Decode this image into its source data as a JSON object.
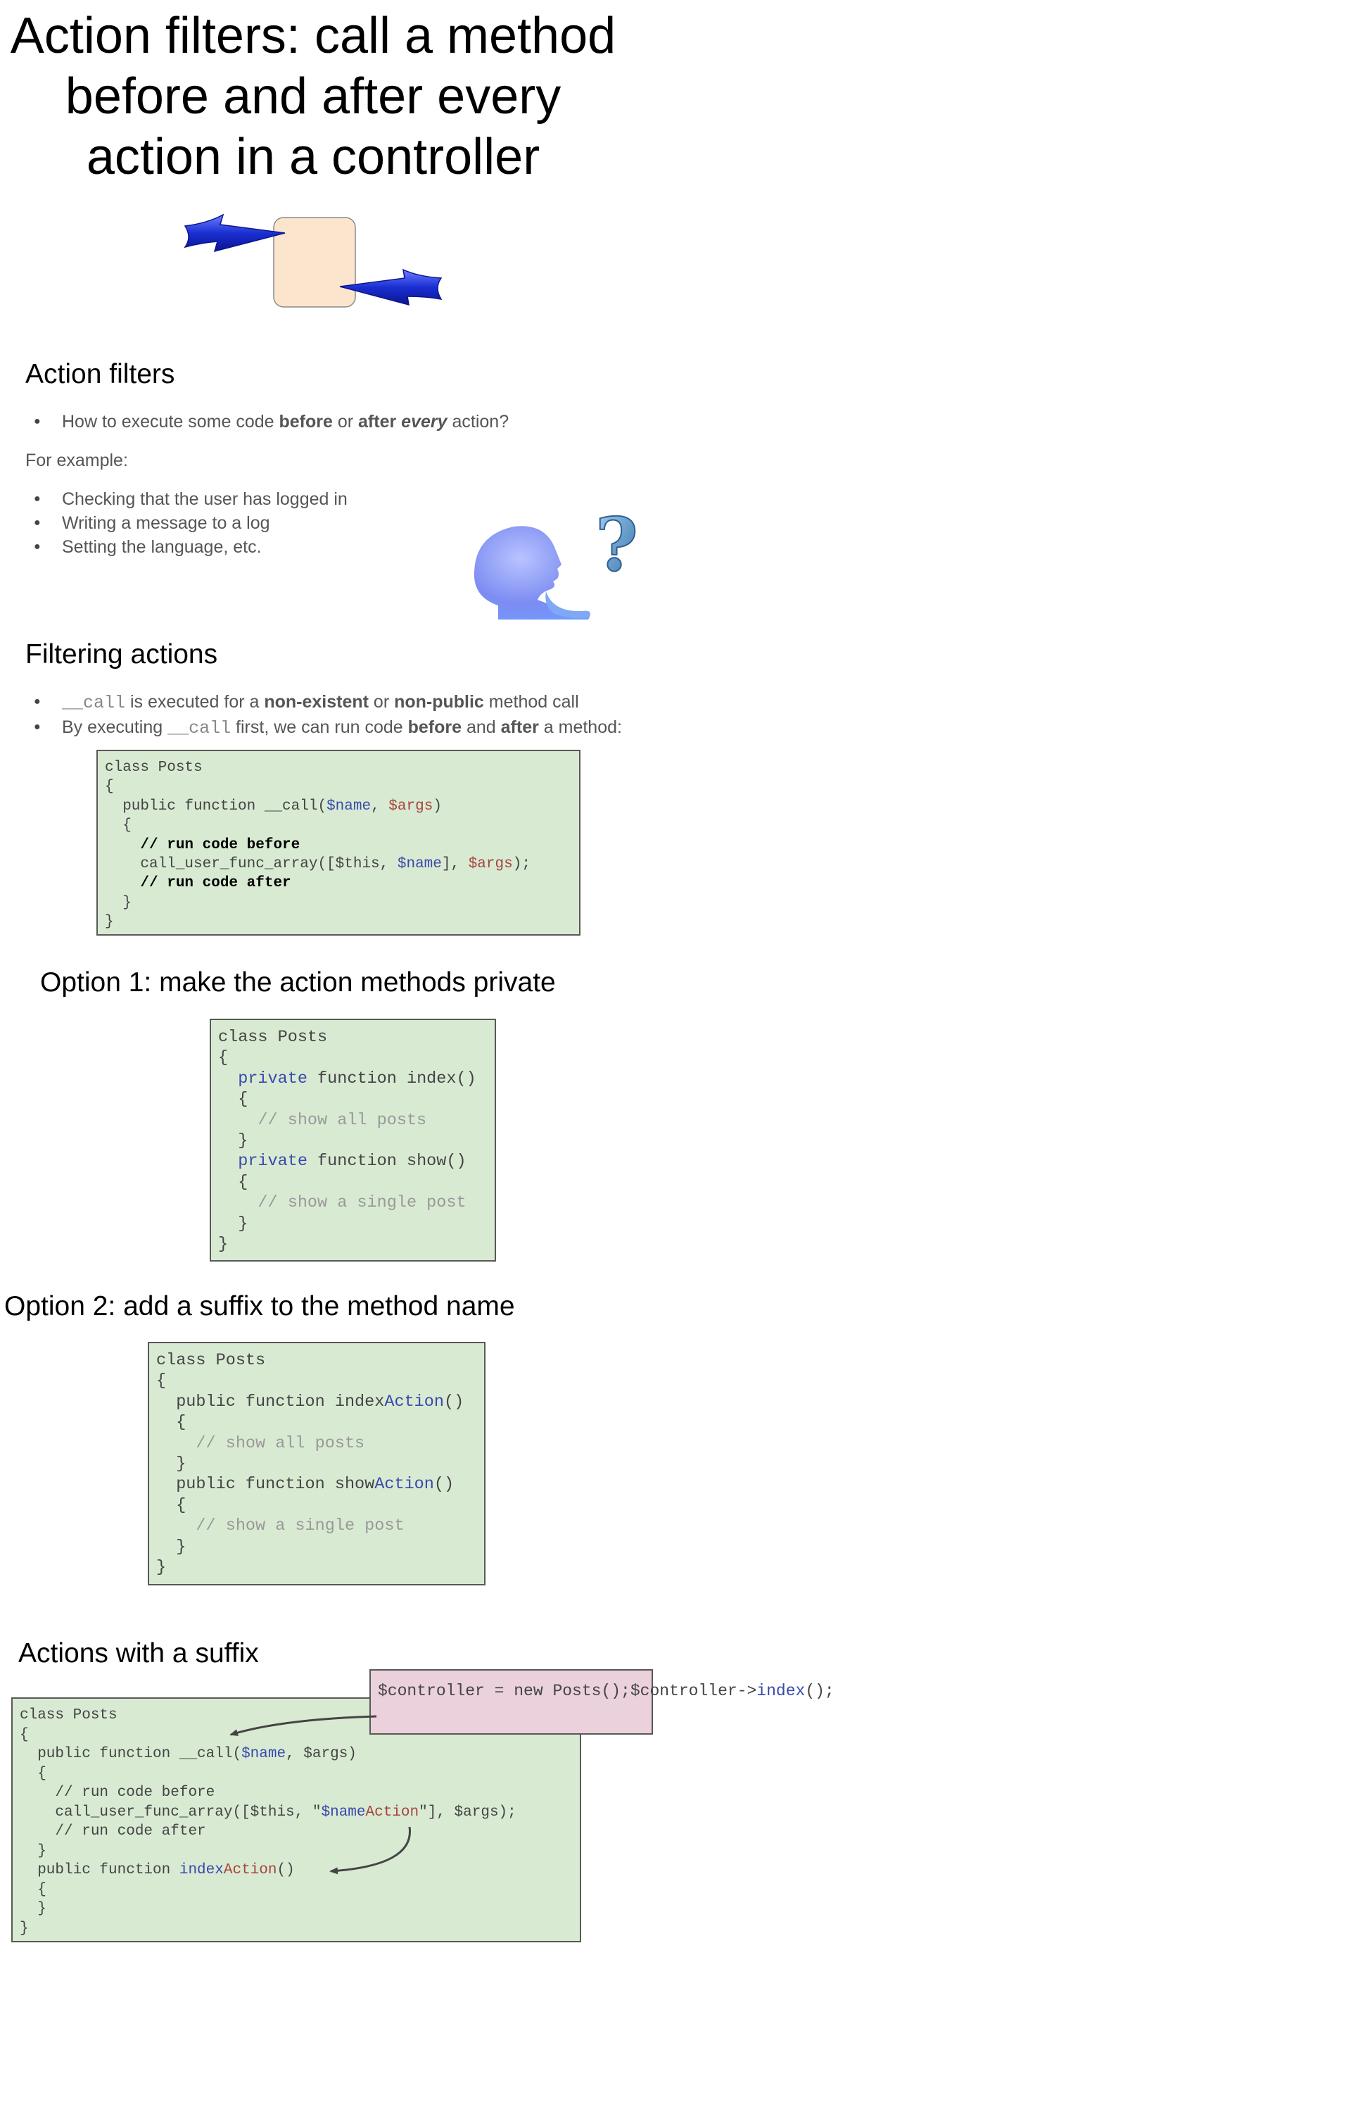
{
  "slide1": {
    "title_lines": [
      "Action filters: call a method",
      "before and after every",
      "action in a controller"
    ]
  },
  "slide2": {
    "heading": "Action filters",
    "bullet1": {
      "pre": "How to execute some code ",
      "b1": "before",
      "mid": " or ",
      "b2": "after",
      "sp": " ",
      "em": "every",
      "post": " action?"
    },
    "for_example": "For example:",
    "bullets": [
      "Checking that the user has logged in",
      "Writing a message to a log",
      "Setting the language, etc."
    ],
    "icon": "thinking-person-question-icon"
  },
  "slide3": {
    "heading": "Filtering actions",
    "bullet1": {
      "code": "__call",
      "mid1": " is executed for a ",
      "b1": "non-existent",
      "mid2": " or ",
      "b2": "non-public",
      "post": " method call"
    },
    "bullet2": {
      "pre": "By executing ",
      "code": "__call",
      "mid1": " first, we can run code ",
      "b1": "before",
      "mid2": " and ",
      "b2": "after",
      "post": " a method:"
    },
    "code": {
      "l1": "class Posts",
      "l2": "{",
      "l3a": "  public function __call(",
      "l3b": "$name",
      "l3c": ", ",
      "l3d": "$args",
      "l3e": ")",
      "l4": "  {",
      "l5": "    // run code before",
      "l6a": "    call_user_func_array([$this, ",
      "l6b": "$name",
      "l6c": "], ",
      "l6d": "$args",
      "l6e": ");",
      "l7": "    // run code after",
      "l8": "  }",
      "l9": "}"
    }
  },
  "slide4": {
    "heading": "Option 1: make the action methods private",
    "code": {
      "l1": "class Posts",
      "l2": "{",
      "l3a": "  ",
      "l3b": "private",
      "l3c": " function index()",
      "l4": "  {",
      "l5": "    // show all posts",
      "l6": "  }",
      "l7a": "  ",
      "l7b": "private",
      "l7c": " function show()",
      "l8": "  {",
      "l9": "    // show a single post",
      "l10": "  }",
      "l11": "}"
    }
  },
  "slide5": {
    "heading": "Option 2: add a suffix to the method name",
    "code": {
      "l1": "class Posts",
      "l2": "{",
      "l3a": "  public function index",
      "l3b": "Action",
      "l3c": "()",
      "l4": "  {",
      "l5": "    // show all posts",
      "l6": "  }",
      "l7a": "  public function show",
      "l7b": "Action",
      "l7c": "()",
      "l8": "  {",
      "l9": "    // show a single post",
      "l10": "  }",
      "l11": "}"
    }
  },
  "slide6": {
    "heading": "Actions with a suffix",
    "code": {
      "l1": "class Posts",
      "l2": "{",
      "l3a": "  public function __call(",
      "l3b": "$name",
      "l3c": ", $args)",
      "l4": "  {",
      "l5": "    // run code before",
      "l6a": "    call_user_func_array([$this, \"",
      "l6b": "$name",
      "l6c": "Action",
      "l6d": "\"], $args);",
      "l7": "    // run code after",
      "l8": "  }",
      "l9a": "  public function ",
      "l9b": "index",
      "l9c": "Action",
      "l9d": "()",
      "l10": "  {",
      "l11": "  }",
      "l12": "}"
    },
    "box": {
      "l1": "$controller = new Posts();",
      "l2a": "$controller->",
      "l2b": "index",
      "l2c": "();"
    }
  }
}
